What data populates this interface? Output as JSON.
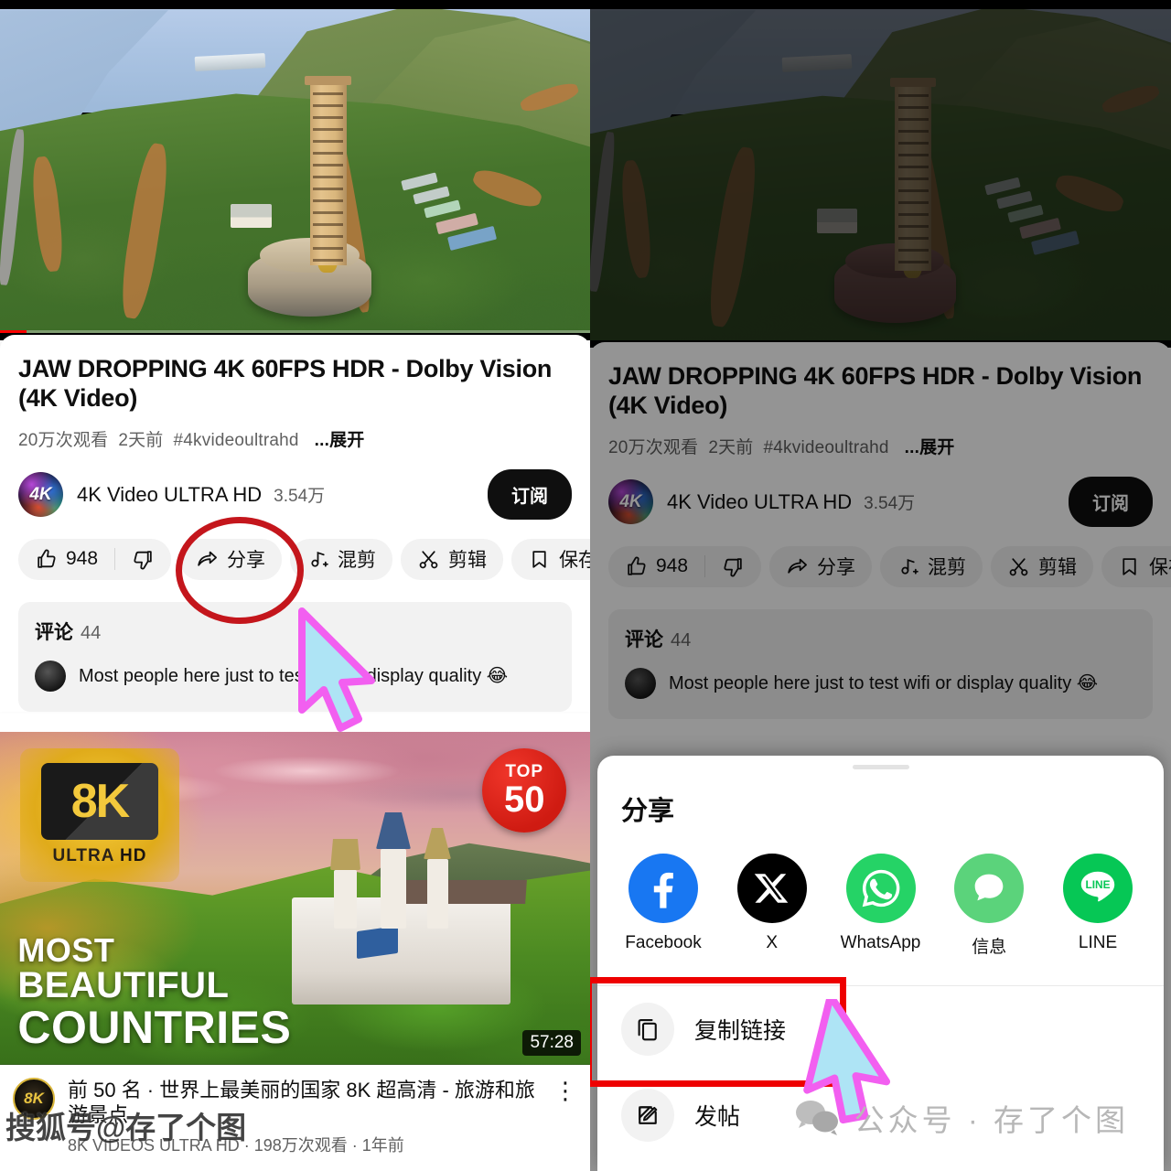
{
  "video": {
    "title": "JAW DROPPING 4K 60FPS HDR - Dolby Vision (4K Video)",
    "views": "20万次观看",
    "published": "2天前",
    "hashtag": "#4kvideoultrahd",
    "expand": "...展开",
    "channel_name": "4K Video ULTRA HD",
    "channel_subs": "3.54万",
    "channel_avatar_text": "4K",
    "subscribe_label": "订阅"
  },
  "actions": {
    "like_count": "948",
    "like_icon": "thumbs-up-icon",
    "dislike_icon": "thumbs-down-icon",
    "share_label": "分享",
    "share_icon": "share-arrow-icon",
    "remix_label": "混剪",
    "remix_icon": "remix-icon",
    "clip_label": "剪辑",
    "clip_icon": "scissors-icon",
    "save_label": "保存",
    "save_icon": "bookmark-icon"
  },
  "comments": {
    "label": "评论",
    "count": "44",
    "top_comment": "Most people here just to test wifi or display quality 😂"
  },
  "upnext": {
    "title": "前 50 名 · 世界上最美丽的国家  8K 超高清 - 旅游和旅游景点",
    "subtitle": "8K VIDEOS ULTRA HD · 198万次观看 · 1年前",
    "duration": "57:28",
    "avatar_text": "8K",
    "menu_icon": "more-vertical-icon",
    "thumb_badge_main": "8K",
    "thumb_badge_sub_1": "ULTRA ",
    "thumb_badge_sub_2": "HD",
    "thumb_top_label": "TOP",
    "thumb_top_number": "50",
    "thumb_line1": "MOST",
    "thumb_line2": "BEAUTIFUL",
    "thumb_line3": "COUNTRIES"
  },
  "share_sheet": {
    "title": "分享",
    "apps": [
      {
        "label": "Facebook",
        "icon": "facebook-icon",
        "color": "#1877f2"
      },
      {
        "label": "X",
        "icon": "x-twitter-icon",
        "color": "#000000"
      },
      {
        "label": "WhatsApp",
        "icon": "whatsapp-icon",
        "color": "#25d366"
      },
      {
        "label": "信息",
        "icon": "messages-icon",
        "color": "#5bd37b"
      },
      {
        "label": "LINE",
        "icon": "line-icon",
        "color": "#06c755"
      }
    ],
    "items": [
      {
        "label": "复制链接",
        "icon": "copy-icon"
      },
      {
        "label": "发帖",
        "icon": "edit-pencil-icon"
      }
    ]
  },
  "annotations": {
    "circle_color": "#c4161c",
    "rect_color": "#ee0000",
    "cursor_fill": "#aee4f5",
    "cursor_stroke": "#f25ff0"
  },
  "watermarks": {
    "sohu": "搜狐号@存了个图",
    "wechat": "公众号 · 存了个图"
  }
}
